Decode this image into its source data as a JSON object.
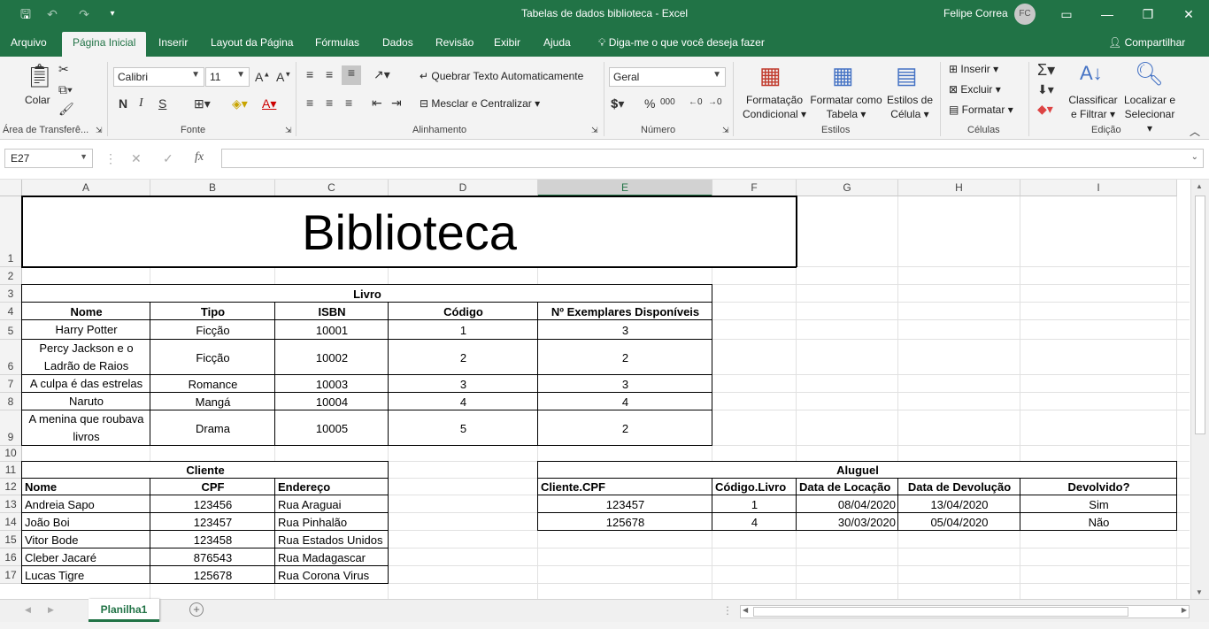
{
  "app": {
    "window_title": "Tabelas de dados biblioteca  -  Excel",
    "user_name": "Felipe Correa",
    "user_initials": "FC"
  },
  "ribbon_tabs": [
    "Arquivo",
    "Página Inicial",
    "Inserir",
    "Layout da Página",
    "Fórmulas",
    "Dados",
    "Revisão",
    "Exibir",
    "Ajuda"
  ],
  "tell_me": "Diga-me o que você deseja fazer",
  "share_label": "Compartilhar",
  "ribbon": {
    "clipboard": {
      "paste_label": "Colar",
      "group_label": "Área de Transferê..."
    },
    "font": {
      "font_name": "Calibri",
      "font_size": "11",
      "bold": "N",
      "italic": "I",
      "underline": "S",
      "group_label": "Fonte"
    },
    "alignment": {
      "wrap_text": "Quebrar Texto Automaticamente",
      "merge_center": "Mesclar e Centralizar",
      "group_label": "Alinhamento"
    },
    "number": {
      "format": "Geral",
      "percent": "%",
      "thousands": "000",
      "group_label": "Número"
    },
    "styles": {
      "conditional_1": "Formatação",
      "conditional_2": "Condicional",
      "table_1": "Formatar como",
      "table_2": "Tabela",
      "cell_1": "Estilos de",
      "cell_2": "Célula",
      "group_label": "Estilos"
    },
    "cells": {
      "insert": "Inserir",
      "delete": "Excluir",
      "format": "Formatar",
      "group_label": "Células"
    },
    "editing": {
      "sort_1": "Classificar",
      "sort_2": "e Filtrar",
      "find_1": "Localizar e",
      "find_2": "Selecionar",
      "group_label": "Edição"
    }
  },
  "formula_bar": {
    "name_box": "E27",
    "fx": "fx",
    "formula": ""
  },
  "columns": [
    "A",
    "B",
    "C",
    "D",
    "E",
    "F",
    "G",
    "H",
    "I"
  ],
  "rows": [
    "1",
    "2",
    "3",
    "4",
    "5",
    "6",
    "7",
    "8",
    "9",
    "10",
    "11",
    "12",
    "13",
    "14",
    "15",
    "16",
    "17"
  ],
  "sheet": {
    "title": "Biblioteca",
    "livro": {
      "header": "Livro",
      "columns": [
        "Nome",
        "Tipo",
        "ISBN",
        "Código",
        "Nº Exemplares Disponíveis"
      ],
      "rows": [
        [
          "Harry Potter",
          "Ficção",
          "10001",
          "1",
          "3"
        ],
        [
          "Percy Jackson e o Ladrão de Raios",
          "Ficção",
          "10002",
          "2",
          "2"
        ],
        [
          "A culpa é das estrelas",
          "Romance",
          "10003",
          "3",
          "3"
        ],
        [
          "Naruto",
          "Mangá",
          "10004",
          "4",
          "4"
        ],
        [
          "A menina que roubava livros",
          "Drama",
          "10005",
          "5",
          "2"
        ]
      ]
    },
    "cliente": {
      "header": "Cliente",
      "columns": [
        "Nome",
        "CPF",
        "Endereço"
      ],
      "rows": [
        [
          "Andreia Sapo",
          "123456",
          "Rua Araguai"
        ],
        [
          "João Boi",
          "123457",
          "Rua Pinhalão"
        ],
        [
          "Vitor Bode",
          "123458",
          "Rua Estados Unidos"
        ],
        [
          "Cleber Jacaré",
          "876543",
          "Rua Madagascar"
        ],
        [
          "Lucas Tigre",
          "125678",
          "Rua Corona Virus"
        ]
      ]
    },
    "aluguel": {
      "header": "Aluguel",
      "columns": [
        "Cliente.CPF",
        "Código.Livro",
        "Data de Locação",
        "Data de Devolução",
        "Devolvido?"
      ],
      "rows": [
        [
          "123457",
          "1",
          "08/04/2020",
          "13/04/2020",
          "Sim"
        ],
        [
          "125678",
          "4",
          "30/03/2020",
          "05/04/2020",
          "Não"
        ]
      ]
    }
  },
  "sheet_tab": "Planilha1"
}
